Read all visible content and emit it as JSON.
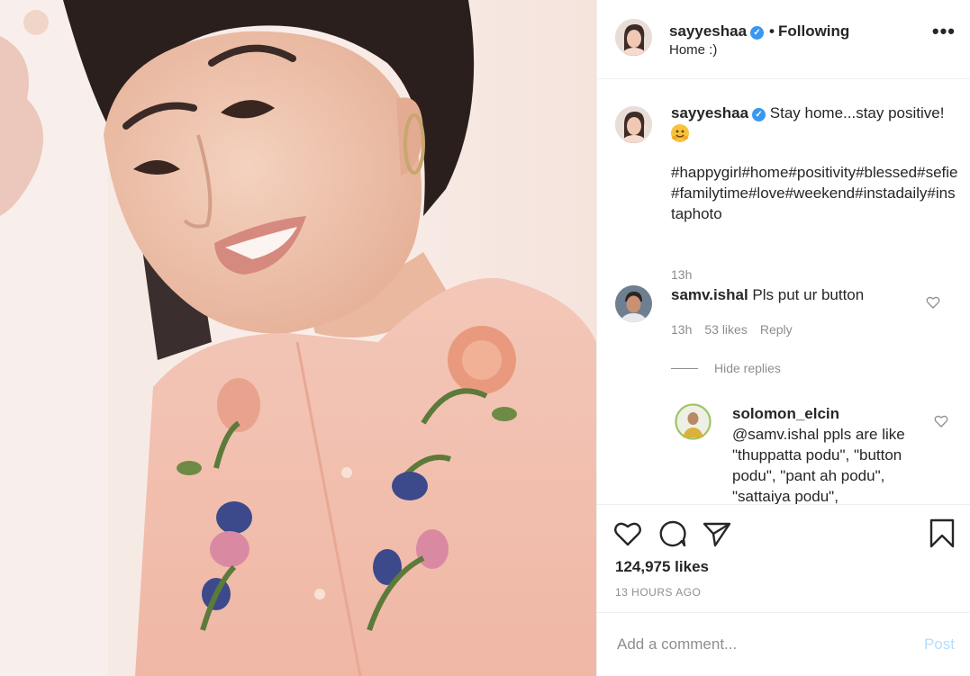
{
  "header": {
    "username": "sayyeshaa",
    "verified_glyph": "✓",
    "dot": "•",
    "follow_status": "Following",
    "location": "Home :)",
    "more_icon": "more-horizontal-icon",
    "more_label": "•••"
  },
  "caption": {
    "username": "sayyeshaa",
    "text": "Stay home...stay positive!",
    "emoji": "hugging-face-emoji",
    "hashtags": "#happygirl#home#positivity#blessed#sefie#familytime#love#weekend#instadaily#instaphoto",
    "time": "13h"
  },
  "comments": [
    {
      "username": "samv.ishal",
      "text": "Pls put ur button",
      "time": "13h",
      "likes": "53 likes",
      "reply_label": "Reply"
    }
  ],
  "hide_replies_label": "Hide replies",
  "reply": {
    "username": "solomon_elcin",
    "text": "@samv.ishal ppls are like \"thuppatta podu\", \"button podu\", \"pant ah podu\", \"sattaiya podu\","
  },
  "actions": {
    "like_count": "124,975 likes",
    "time_ago": "13 HOURS AGO"
  },
  "add_comment": {
    "placeholder": "Add a comment...",
    "post_label": "Post"
  },
  "colors": {
    "accent": "#3897f0",
    "post_disabled": "#b2dffc",
    "secondary_text": "#8e8e8e",
    "border": "#efefef"
  }
}
